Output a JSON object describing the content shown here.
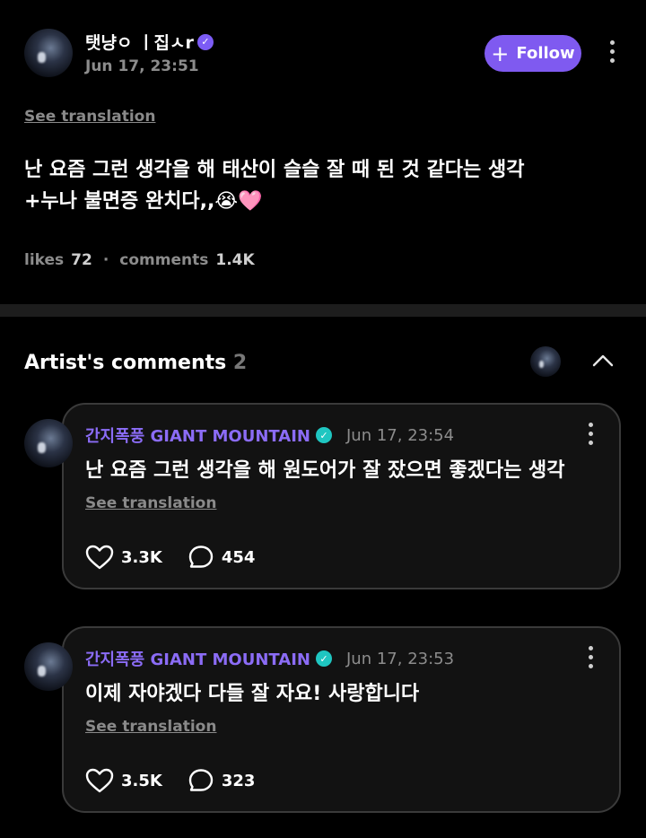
{
  "post": {
    "username": "탯냥ㅇ ㅣ집ㅅr",
    "time": "Jun 17, 23:51",
    "follow_label": "Follow",
    "see_translation": "See translation",
    "body": "난 요즘 그런 생각을 해 태산이 슬슬 잘 때 된 것 같다는 생각\n+누나 불면증 완치다,,😭🩷",
    "likes_label": "likes",
    "likes_count": "72",
    "comments_label": "comments",
    "comments_count": "1.4K",
    "stats_dot": "·"
  },
  "artist_comments": {
    "title": "Artist's comments",
    "count": "2",
    "items": [
      {
        "name": "간지폭풍 GIANT MOUNTAIN",
        "time": "Jun 17, 23:54",
        "text": "난 요즘 그런 생각을 해 원도어가 잘 잤으면 좋겠다는 생각",
        "see_translation": "See translation",
        "likes": "3.3K",
        "replies": "454"
      },
      {
        "name": "간지폭풍 GIANT MOUNTAIN",
        "time": "Jun 17, 23:53",
        "text": "이제 자야겠다 다들 잘 자요! 사랑합니다",
        "see_translation": "See translation",
        "likes": "3.5K",
        "replies": "323"
      }
    ]
  },
  "icons": {
    "verified_purple": "verified-badge-icon",
    "verified_teal": "verified-badge-icon",
    "more": "more-vertical-icon",
    "chevron": "chevron-up-icon",
    "heart": "heart-icon",
    "comment": "comment-bubble-icon"
  },
  "colors": {
    "accent": "#7f5af0",
    "artist_name": "#8b6cf6",
    "verified_artist": "#1fc6c1"
  }
}
